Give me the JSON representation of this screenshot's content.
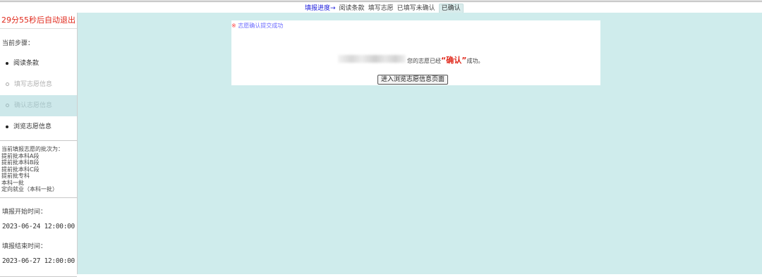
{
  "progress": {
    "label": "填报进度→",
    "steps": [
      "阅读条款",
      "填写志愿",
      "已填写未确认"
    ],
    "current": "已确认"
  },
  "sidebar": {
    "timer": "29分55秒后自动退出",
    "current_step_title": "当前步骤：",
    "steps": [
      {
        "label": "阅读条款",
        "state": "done"
      },
      {
        "label": "填写志愿信息",
        "state": "disabled"
      },
      {
        "label": "确认志愿信息",
        "state": "active"
      },
      {
        "label": "浏览志愿信息",
        "state": "done"
      }
    ],
    "batch_title": "当前填报志愿的批次为：",
    "batches": [
      "提前批本科A段",
      "提前批本科B段",
      "提前批本科C段",
      "提前批专科",
      "本科一批",
      "定向就业（本科一批）"
    ],
    "start_label": "填报开始时间：",
    "start_time": "2023-06-24 12:00:00",
    "end_label": "填报结束时间：",
    "end_time": "2023-06-27 12:00:00"
  },
  "main": {
    "notice_star": "※",
    "notice": "志愿确认提交成功",
    "message_prefix": "您的志愿已经",
    "message_highlight": "“确认”",
    "message_suffix": "成功。",
    "button_label": "进入浏览志愿信息页面"
  },
  "colors": {
    "accent_red": "#e0291c",
    "panel_bg": "#cfecec",
    "link_blue": "#1a1adb"
  }
}
